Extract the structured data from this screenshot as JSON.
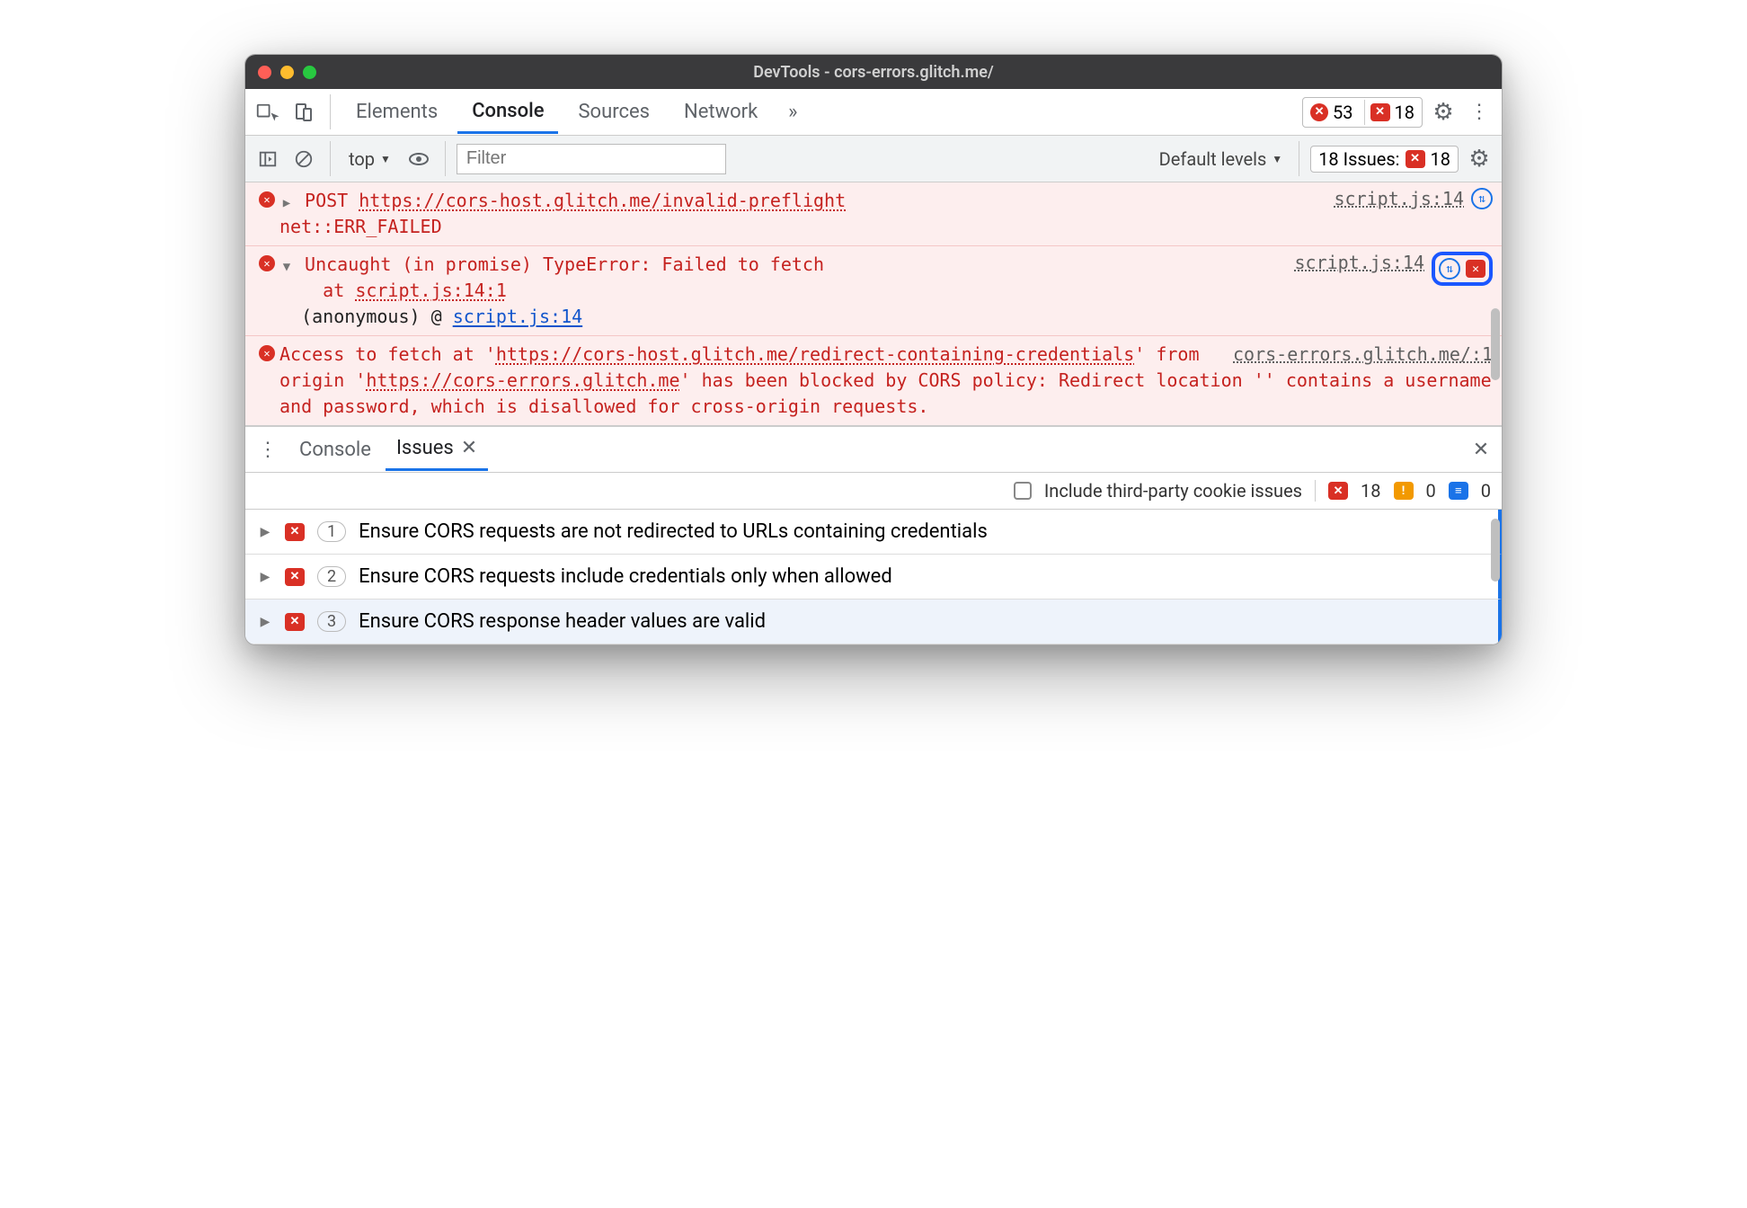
{
  "window": {
    "title": "DevTools - cors-errors.glitch.me/"
  },
  "tabs": {
    "elements": "Elements",
    "console": "Console",
    "sources": "Sources",
    "network": "Network"
  },
  "counters": {
    "errors": "53",
    "issues_top": "18"
  },
  "toolbar2": {
    "context": "top",
    "filter_placeholder": "Filter",
    "levels": "Default levels",
    "issues_prefix": "18 Issues:",
    "issues_count": "18"
  },
  "console": {
    "row1": {
      "method": "POST",
      "url": "https://cors-host.glitch.me/invalid-preflight",
      "err": "net::ERR_FAILED",
      "src": "script.js:14"
    },
    "row2": {
      "headline": "Uncaught (in promise) TypeError: Failed to fetch",
      "at_prefix": "at",
      "at_loc": "script.js:14:1",
      "anon": "(anonymous)",
      "at_sym": "@",
      "anon_loc": "script.js:14",
      "src": "script.js:14"
    },
    "row3": {
      "p1": "Access to fetch at '",
      "url1a": "https://cors-host.glitch.me/redi",
      "url1b": "rect-containing-credentials",
      "p2": "' from origin '",
      "url2": "https://cors-errors.glitch.me",
      "p3": "' has been blocked by CORS policy: Redirect location '' contains a username and password, which is disallowed for cross-origin requests.",
      "src": "cors-errors.glitch.me/:1"
    }
  },
  "drawer": {
    "console_tab": "Console",
    "issues_tab": "Issues",
    "include_label": "Include third-party cookie issues",
    "counts": {
      "errors": "18",
      "warnings": "0",
      "info": "0"
    },
    "rows": [
      {
        "count": "1",
        "title": "Ensure CORS requests are not redirected to URLs containing credentials"
      },
      {
        "count": "2",
        "title": "Ensure CORS requests include credentials only when allowed"
      },
      {
        "count": "3",
        "title": "Ensure CORS response header values are valid"
      }
    ]
  }
}
